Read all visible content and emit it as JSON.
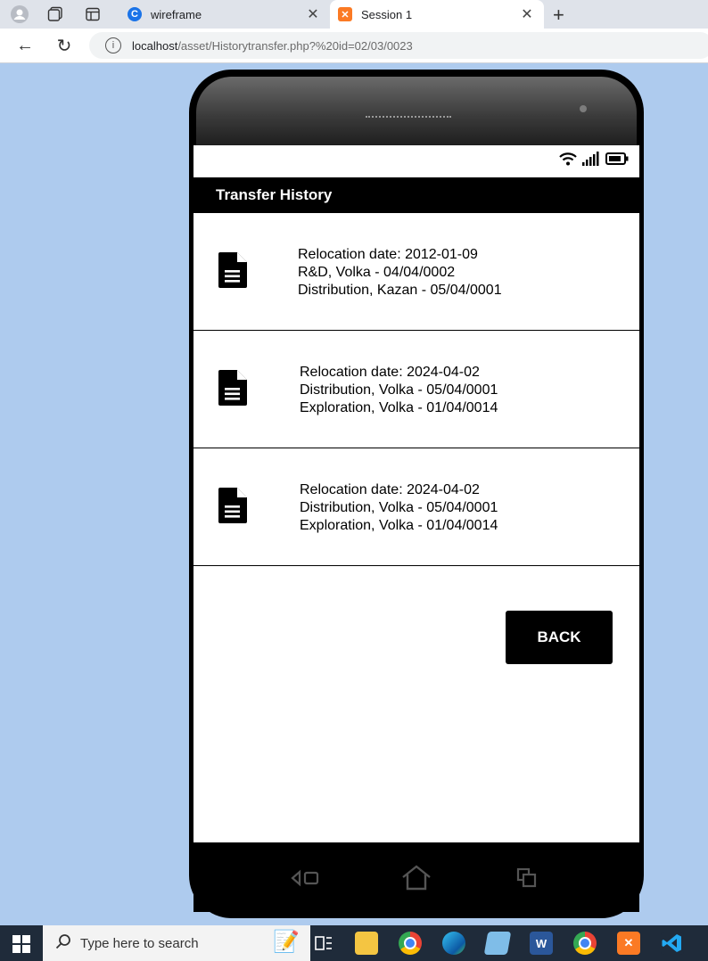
{
  "browser": {
    "tabs": [
      {
        "title": "wireframe",
        "favicon": "copilot-icon",
        "active": false
      },
      {
        "title": "Session 1",
        "favicon": "xampp-icon",
        "active": true
      }
    ],
    "url_host": "localhost",
    "url_path": "/asset/Historytransfer.php?%20id=02/03/0023"
  },
  "app": {
    "header_title": "Transfer History",
    "transfers": [
      {
        "date_line": "Relocation date: 2012-01-09",
        "from_line": "R&D, Volka - 04/04/0002",
        "to_line": "Distribution, Kazan - 05/04/0001"
      },
      {
        "date_line": "Relocation date: 2024-04-02",
        "from_line": "Distribution, Volka - 05/04/0001",
        "to_line": "Exploration, Volka - 01/04/0014"
      },
      {
        "date_line": "Relocation date: 2024-04-02",
        "from_line": "Distribution, Volka - 05/04/0001",
        "to_line": "Exploration, Volka - 01/04/0014"
      }
    ],
    "back_label": "BACK"
  },
  "taskbar": {
    "search_placeholder": "Type here to search",
    "apps": [
      "task-view-icon",
      "file-explorer-icon",
      "chrome-icon",
      "edge-icon",
      "notepad-icon",
      "word-icon",
      "chrome-profile-icon",
      "xampp-icon",
      "vscode-icon"
    ]
  },
  "colors": {
    "page_bg": "#aecbee",
    "header_bg": "#000000",
    "button_bg": "#000000",
    "xampp": "#fb7a24"
  }
}
